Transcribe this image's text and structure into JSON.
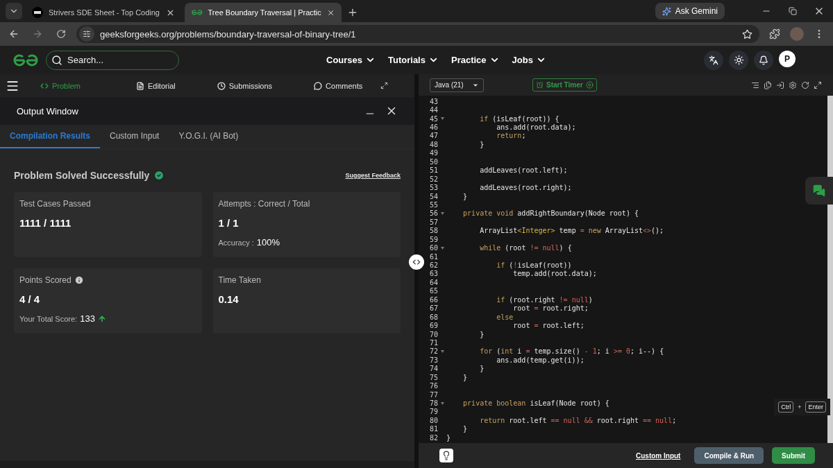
{
  "browser": {
    "tabs": [
      {
        "title": "Strivers SDE Sheet - Top Coding",
        "selected": false
      },
      {
        "title": "Tree Boundary Traversal | Practic",
        "selected": true
      }
    ],
    "ask_gemini": "Ask Gemini",
    "url": "geeksforgeeks.org/problems/boundary-traversal-of-binary-tree/1"
  },
  "site": {
    "search": {
      "placeholder": "Search..."
    },
    "nav": [
      "Courses",
      "Tutorials",
      "Practice",
      "Jobs"
    ],
    "avatar": "P"
  },
  "problem_nav": [
    {
      "label": "Problem",
      "selected": true
    },
    {
      "label": "Editorial",
      "selected": false
    },
    {
      "label": "Submissions",
      "selected": false
    },
    {
      "label": "Comments",
      "selected": false
    }
  ],
  "output_window": {
    "title": "Output Window",
    "tabs": [
      {
        "label": "Compilation Results",
        "selected": true
      },
      {
        "label": "Custom Input",
        "selected": false
      },
      {
        "label": "Y.O.G.I. (AI Bot)",
        "selected": false
      }
    ],
    "status": "Problem Solved Successfully",
    "feedback_link": "Suggest Feedback",
    "cards": [
      {
        "label": "Test Cases Passed",
        "value": "1111 / 1111",
        "info": false
      },
      {
        "label": "Attempts : Correct / Total",
        "value": "1 / 1",
        "info": false,
        "note": {
          "label": "Accuracy :",
          "value": "100%",
          "rising": false
        }
      },
      {
        "label": "Points Scored",
        "value": "4 / 4",
        "info": true,
        "note": {
          "label": "Your Total Score:",
          "value": "133",
          "rising": true
        }
      },
      {
        "label": "Time Taken",
        "value": "0.14",
        "info": false
      }
    ]
  },
  "editor": {
    "language": "Java (21)",
    "timer": "Start Timer",
    "lines": [
      {
        "number": "43",
        "fold": false
      },
      {
        "number": "44",
        "fold": false
      },
      {
        "number": "45",
        "fold": true,
        "tokens": [
          {
            "kind": "keyword",
            "text": "        if"
          },
          {
            "kind": "plain",
            "text": " (isLeaf(root)) {"
          }
        ]
      },
      {
        "number": "46",
        "fold": false,
        "tokens": [
          {
            "kind": "plain",
            "text": "            ans.add(root.data);"
          }
        ]
      },
      {
        "number": "47",
        "fold": false,
        "tokens": [
          {
            "kind": "keyword",
            "text": "            return"
          },
          {
            "kind": "plain",
            "text": ";"
          }
        ]
      },
      {
        "number": "48",
        "fold": false,
        "tokens": [
          {
            "kind": "plain",
            "text": "        }"
          }
        ]
      },
      {
        "number": "49",
        "fold": false
      },
      {
        "number": "50",
        "fold": false
      },
      {
        "number": "51",
        "fold": false,
        "tokens": [
          {
            "kind": "plain",
            "text": "        addLeaves(root.left);"
          }
        ]
      },
      {
        "number": "52",
        "fold": false
      },
      {
        "number": "53",
        "fold": false,
        "tokens": [
          {
            "kind": "plain",
            "text": "        addLeaves(root.right);"
          }
        ]
      },
      {
        "number": "54",
        "fold": false,
        "tokens": [
          {
            "kind": "plain",
            "text": "    }"
          }
        ]
      },
      {
        "number": "55",
        "fold": false
      },
      {
        "number": "56",
        "fold": true,
        "tokens": [
          {
            "kind": "keyword",
            "text": "    private void"
          },
          {
            "kind": "plain",
            "text": " addRightBoundary(Node root) {"
          }
        ]
      },
      {
        "number": "57",
        "fold": false
      },
      {
        "number": "58",
        "fold": false,
        "tokens": [
          {
            "kind": "plain",
            "text": "        ArrayList"
          },
          {
            "kind": "type",
            "text": "<Integer>"
          },
          {
            "kind": "plain",
            "text": " temp "
          },
          {
            "kind": "operator",
            "text": "="
          },
          {
            "kind": "keyword",
            "text": " new"
          },
          {
            "kind": "plain",
            "text": " ArrayList"
          },
          {
            "kind": "operator",
            "text": "<>"
          },
          {
            "kind": "plain",
            "text": "();"
          }
        ]
      },
      {
        "number": "59",
        "fold": false
      },
      {
        "number": "60",
        "fold": true,
        "tokens": [
          {
            "kind": "keyword",
            "text": "        while"
          },
          {
            "kind": "plain",
            "text": " (root "
          },
          {
            "kind": "operator",
            "text": "!="
          },
          {
            "kind": "literal",
            "text": " null"
          },
          {
            "kind": "plain",
            "text": ") {"
          }
        ]
      },
      {
        "number": "61",
        "fold": false
      },
      {
        "number": "62",
        "fold": false,
        "tokens": [
          {
            "kind": "keyword",
            "text": "            if"
          },
          {
            "kind": "plain",
            "text": " ("
          },
          {
            "kind": "operator",
            "text": "!"
          },
          {
            "kind": "plain",
            "text": "isLeaf(root))"
          }
        ]
      },
      {
        "number": "63",
        "fold": false,
        "tokens": [
          {
            "kind": "plain",
            "text": "                temp.add(root.data);"
          }
        ]
      },
      {
        "number": "64",
        "fold": false
      },
      {
        "number": "65",
        "fold": false
      },
      {
        "number": "66",
        "fold": false,
        "tokens": [
          {
            "kind": "keyword",
            "text": "            if"
          },
          {
            "kind": "plain",
            "text": " (root.right "
          },
          {
            "kind": "operator",
            "text": "!="
          },
          {
            "kind": "literal",
            "text": " null"
          },
          {
            "kind": "plain",
            "text": ")"
          }
        ]
      },
      {
        "number": "67",
        "fold": false,
        "tokens": [
          {
            "kind": "plain",
            "text": "                root "
          },
          {
            "kind": "operator",
            "text": "="
          },
          {
            "kind": "plain",
            "text": " root.right;"
          }
        ]
      },
      {
        "number": "68",
        "fold": false,
        "tokens": [
          {
            "kind": "keyword",
            "text": "            else"
          }
        ]
      },
      {
        "number": "69",
        "fold": false,
        "tokens": [
          {
            "kind": "plain",
            "text": "                root "
          },
          {
            "kind": "operator",
            "text": "="
          },
          {
            "kind": "plain",
            "text": " root.left;"
          }
        ]
      },
      {
        "number": "70",
        "fold": false,
        "tokens": [
          {
            "kind": "plain",
            "text": "        }"
          }
        ]
      },
      {
        "number": "71",
        "fold": false
      },
      {
        "number": "72",
        "fold": true,
        "tokens": [
          {
            "kind": "keyword",
            "text": "        for"
          },
          {
            "kind": "plain",
            "text": " ("
          },
          {
            "kind": "keyword",
            "text": "int"
          },
          {
            "kind": "plain",
            "text": " i "
          },
          {
            "kind": "operator",
            "text": "="
          },
          {
            "kind": "plain",
            "text": " temp.size() "
          },
          {
            "kind": "operator",
            "text": "-"
          },
          {
            "kind": "literal",
            "text": " 1"
          },
          {
            "kind": "plain",
            "text": "; i "
          },
          {
            "kind": "operator",
            "text": ">="
          },
          {
            "kind": "literal",
            "text": " 0"
          },
          {
            "kind": "plain",
            "text": "; i--) {"
          }
        ]
      },
      {
        "number": "73",
        "fold": false,
        "tokens": [
          {
            "kind": "plain",
            "text": "            ans.add(temp.get(i));"
          }
        ]
      },
      {
        "number": "74",
        "fold": false,
        "tokens": [
          {
            "kind": "plain",
            "text": "        }"
          }
        ]
      },
      {
        "number": "75",
        "fold": false,
        "tokens": [
          {
            "kind": "plain",
            "text": "    }"
          }
        ]
      },
      {
        "number": "76",
        "fold": false
      },
      {
        "number": "77",
        "fold": false
      },
      {
        "number": "78",
        "fold": true,
        "tokens": [
          {
            "kind": "keyword",
            "text": "    private boolean"
          },
          {
            "kind": "plain",
            "text": " isLeaf(Node root) {"
          }
        ]
      },
      {
        "number": "79",
        "fold": false
      },
      {
        "number": "80",
        "fold": false,
        "tokens": [
          {
            "kind": "keyword",
            "text": "        return"
          },
          {
            "kind": "plain",
            "text": " root.left "
          },
          {
            "kind": "operator",
            "text": "=="
          },
          {
            "kind": "literal",
            "text": " null"
          },
          {
            "kind": "operator",
            "text": " &&"
          },
          {
            "kind": "plain",
            "text": " root.right "
          },
          {
            "kind": "operator",
            "text": "=="
          },
          {
            "kind": "literal",
            "text": " null"
          },
          {
            "kind": "plain",
            "text": ";"
          }
        ]
      },
      {
        "number": "81",
        "fold": false,
        "tokens": [
          {
            "kind": "plain",
            "text": "    }"
          }
        ]
      },
      {
        "number": "82",
        "fold": false,
        "tokens": [
          {
            "kind": "plain",
            "text": "}"
          }
        ]
      }
    ],
    "shortcut": [
      "Ctrl",
      "+",
      "Enter"
    ],
    "custom_input": "Custom Input",
    "compile": "Compile & Run",
    "submit": "Submit"
  }
}
